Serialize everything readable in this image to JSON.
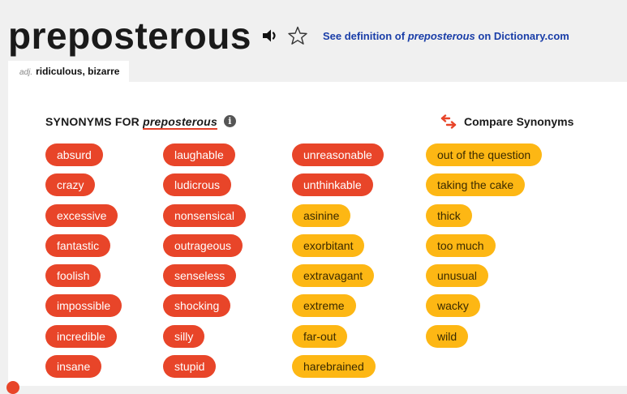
{
  "header": {
    "word": "preposterous",
    "definition_link": {
      "prefix": "See definition of ",
      "word": "preposterous",
      "suffix": " on Dictionary.com"
    }
  },
  "tab": {
    "pos": "adj.",
    "label": "ridiculous, bizarre"
  },
  "synonyms": {
    "title_prefix": "SYNONYMS FOR ",
    "title_word": "preposterous",
    "info_icon": "info-icon",
    "compare_label": "Compare Synonyms",
    "colors": {
      "strongest": "#e84529",
      "strong": "#fdb714"
    },
    "columns": [
      [
        {
          "label": "absurd",
          "strength": "red"
        },
        {
          "label": "crazy",
          "strength": "red"
        },
        {
          "label": "excessive",
          "strength": "red"
        },
        {
          "label": "fantastic",
          "strength": "red"
        },
        {
          "label": "foolish",
          "strength": "red"
        },
        {
          "label": "impossible",
          "strength": "red"
        },
        {
          "label": "incredible",
          "strength": "red"
        },
        {
          "label": "insane",
          "strength": "red"
        }
      ],
      [
        {
          "label": "laughable",
          "strength": "red"
        },
        {
          "label": "ludicrous",
          "strength": "red"
        },
        {
          "label": "nonsensical",
          "strength": "red"
        },
        {
          "label": "outrageous",
          "strength": "red"
        },
        {
          "label": "senseless",
          "strength": "red"
        },
        {
          "label": "shocking",
          "strength": "red"
        },
        {
          "label": "silly",
          "strength": "red"
        },
        {
          "label": "stupid",
          "strength": "red"
        }
      ],
      [
        {
          "label": "unreasonable",
          "strength": "red"
        },
        {
          "label": "unthinkable",
          "strength": "red"
        },
        {
          "label": "asinine",
          "strength": "amber"
        },
        {
          "label": "exorbitant",
          "strength": "amber"
        },
        {
          "label": "extravagant",
          "strength": "amber"
        },
        {
          "label": "extreme",
          "strength": "amber"
        },
        {
          "label": "far-out",
          "strength": "amber"
        },
        {
          "label": "harebrained",
          "strength": "amber"
        }
      ],
      [
        {
          "label": "out of the question",
          "strength": "amber"
        },
        {
          "label": "taking the cake",
          "strength": "amber"
        },
        {
          "label": "thick",
          "strength": "amber"
        },
        {
          "label": "too much",
          "strength": "amber"
        },
        {
          "label": "unusual",
          "strength": "amber"
        },
        {
          "label": "wacky",
          "strength": "amber"
        },
        {
          "label": "wild",
          "strength": "amber"
        }
      ]
    ]
  }
}
